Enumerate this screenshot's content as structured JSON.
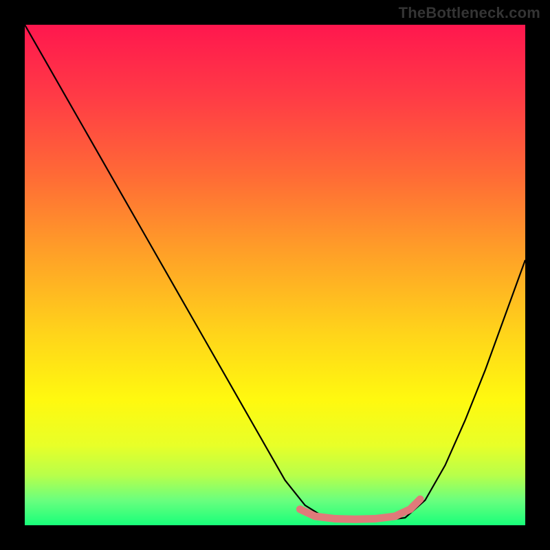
{
  "watermark": "TheBottleneck.com",
  "gradient_stops": [
    {
      "offset": 0.0,
      "color": "#ff174e"
    },
    {
      "offset": 0.14,
      "color": "#ff3a46"
    },
    {
      "offset": 0.3,
      "color": "#ff6a36"
    },
    {
      "offset": 0.45,
      "color": "#ff9e28"
    },
    {
      "offset": 0.62,
      "color": "#ffd51a"
    },
    {
      "offset": 0.75,
      "color": "#fff90f"
    },
    {
      "offset": 0.84,
      "color": "#e8ff28"
    },
    {
      "offset": 0.9,
      "color": "#b8ff4a"
    },
    {
      "offset": 0.95,
      "color": "#6aff7e"
    },
    {
      "offset": 1.0,
      "color": "#18ff7a"
    }
  ],
  "chart_data": {
    "type": "line",
    "title": "",
    "xlabel": "",
    "ylabel": "",
    "xlim": [
      0,
      100
    ],
    "ylim": [
      0,
      100
    ],
    "grid": false,
    "annotations": [
      "TheBottleneck.com"
    ],
    "series": [
      {
        "name": "bottleneck-curve",
        "color": "#000000",
        "width": 2.2,
        "x": [
          0,
          4,
          8,
          12,
          16,
          20,
          24,
          28,
          32,
          36,
          40,
          44,
          48,
          52,
          56,
          60,
          64,
          68,
          72,
          76,
          80,
          84,
          88,
          92,
          96,
          100
        ],
        "y": [
          100,
          93,
          86,
          79,
          72,
          65,
          58,
          51,
          44,
          37,
          30,
          23,
          16,
          9,
          4,
          1.5,
          1,
          1,
          1,
          1.5,
          5,
          12,
          21,
          31,
          42,
          53
        ]
      },
      {
        "name": "optimal-band",
        "color": "#e07a7a",
        "width": 11,
        "linecap": "round",
        "x": [
          55,
          58,
          62,
          66,
          70,
          74,
          77,
          79
        ],
        "y": [
          3.2,
          1.8,
          1.3,
          1.2,
          1.3,
          1.8,
          3.2,
          5.2
        ]
      }
    ]
  }
}
